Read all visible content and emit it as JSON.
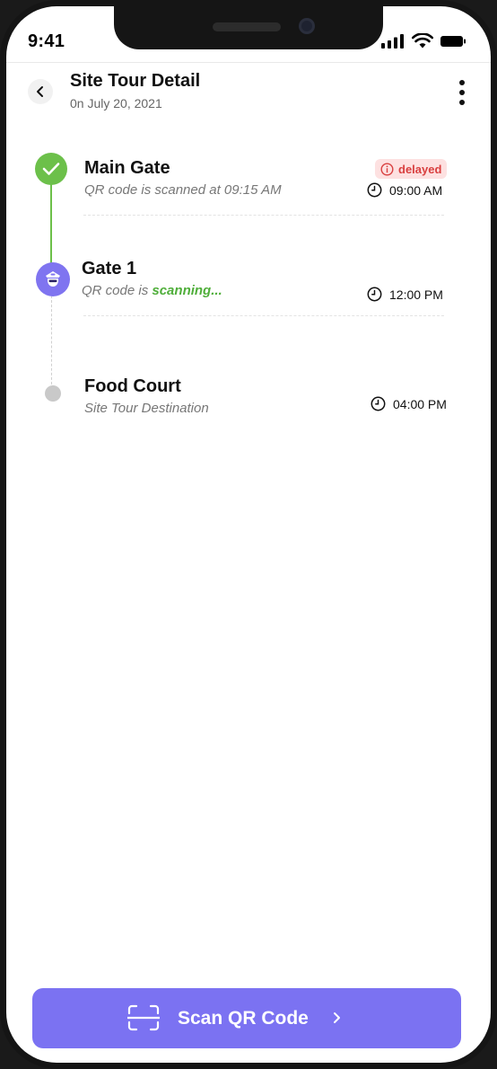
{
  "status_bar": {
    "time": "9:41"
  },
  "header": {
    "title": "Site Tour Detail",
    "subtitle": "0n July 20, 2021"
  },
  "stops": [
    {
      "name": "Main Gate",
      "subtitle": "QR code is scanned at 09:15  AM",
      "time": "09:00 AM",
      "badge": "delayed",
      "status": "completed"
    },
    {
      "name": "Gate 1",
      "subtitle_prefix": "QR code is ",
      "subtitle_highlight": "scanning...",
      "time": "12:00 PM",
      "status": "in-progress"
    },
    {
      "name": "Food Court",
      "subtitle": "Site Tour Destination",
      "time": "04:00 PM",
      "status": "pending"
    }
  ],
  "footer": {
    "scan_button_label": "Scan QR Code"
  },
  "colors": {
    "accent": "#7b72f2",
    "success": "#6cc04a",
    "warning_bg": "#fde1e1",
    "warning_text": "#d94040"
  }
}
